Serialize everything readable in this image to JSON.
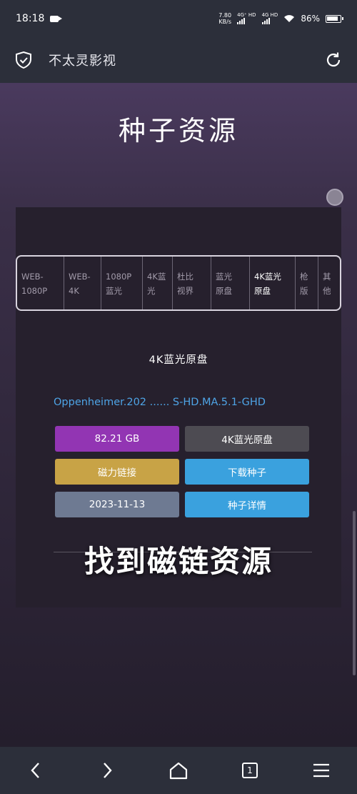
{
  "status": {
    "time": "18:18",
    "speed_value": "7.80",
    "speed_unit": "KB/s",
    "signal1": "4G⁺ HD",
    "signal2": "4G HD",
    "battery": "86%"
  },
  "appbar": {
    "title": "不太灵影视"
  },
  "page": {
    "title": "种子资源"
  },
  "tabs": [
    {
      "label": "WEB-\n1080P"
    },
    {
      "label": "WEB-\n4K"
    },
    {
      "label": "1080P\n蓝光"
    },
    {
      "label": "4K蓝\n光"
    },
    {
      "label": "杜比\n视界"
    },
    {
      "label": "蓝光\n原盘"
    },
    {
      "label": "4K蓝光\n原盘"
    },
    {
      "label": "枪\n版"
    },
    {
      "label": "其\n他"
    }
  ],
  "active_tab_index": 6,
  "section": {
    "label": "4K蓝光原盘"
  },
  "torrent": {
    "filename": "Oppenheimer.202 ...... S-HD.MA.5.1-GHD",
    "size": "82.21 GB",
    "type": "4K蓝光原盘",
    "magnet": "磁力链接",
    "download": "下载种子",
    "date": "2023-11-13",
    "detail": "种子详情"
  },
  "overlay": {
    "text": "找到磁链资源"
  },
  "nav": {
    "tab_count": "1"
  },
  "colors": {
    "size_btn": "#9235b3",
    "type_btn": "#4d4b52",
    "magnet_btn": "#c8a346",
    "download_btn": "#3aa1de",
    "date_btn": "#6e7a92",
    "detail_btn": "#3aa1de",
    "filename": "#4ea4e6"
  }
}
